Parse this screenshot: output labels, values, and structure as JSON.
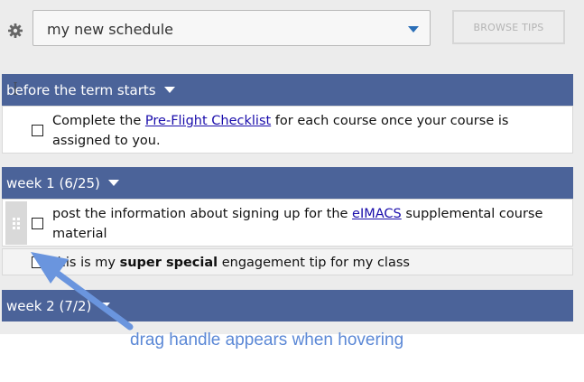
{
  "toolbar": {
    "schedule_selected": "my new schedule",
    "browse_label": "BROWSE TIPS"
  },
  "sections": [
    {
      "title": "before the term starts",
      "tasks": [
        {
          "text_before": "Complete the ",
          "link": "Pre-Flight Checklist",
          "text_after": " for each course once your course is assigned to you."
        }
      ]
    },
    {
      "title": "week 1 (6/25)",
      "tasks": [
        {
          "text_before": "post the information about signing up for the ",
          "link": "eIMACS",
          "text_after": " supplemental course material"
        },
        {
          "text_before": "this is my ",
          "bold": "super special",
          "text_after": " engagement tip for my class"
        }
      ]
    },
    {
      "title": "week 2 (7/2)"
    }
  ],
  "annotation": {
    "text": "drag handle appears when hovering",
    "color": "#5b88d6"
  }
}
